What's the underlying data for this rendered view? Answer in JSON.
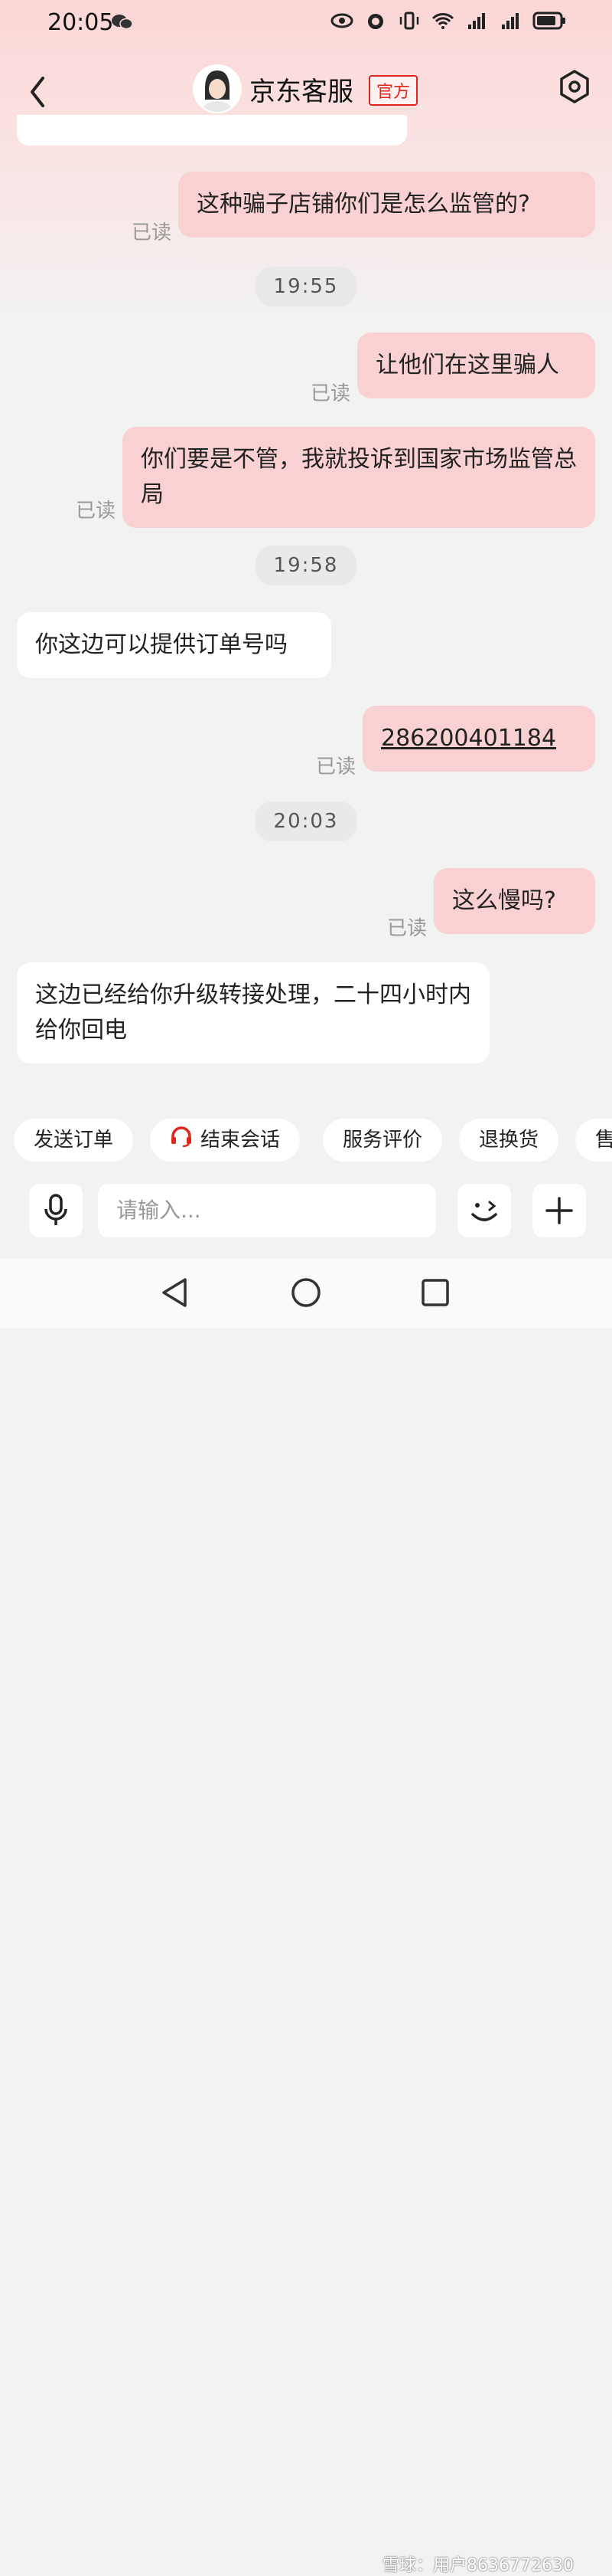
{
  "status": {
    "time": "20:05"
  },
  "header": {
    "title": "京东客服",
    "badge": "官方"
  },
  "messages": [
    {
      "from": "me",
      "text": "这种骗子店铺你们是怎么监管的?",
      "read": "已读"
    },
    {
      "timestamp": "19:55"
    },
    {
      "from": "me",
      "text": "让他们在这里骗人",
      "read": "已读"
    },
    {
      "from": "me",
      "text": "你们要是不管，我就投诉到国家市场监管总局",
      "read": "已读"
    },
    {
      "timestamp": "19:58"
    },
    {
      "from": "them",
      "text": "你这边可以提供订单号吗"
    },
    {
      "from": "me",
      "text": "286200401184",
      "read": "已读"
    },
    {
      "timestamp": "20:03"
    },
    {
      "from": "me",
      "text": "这么慢吗?",
      "read": "已读"
    },
    {
      "from": "them",
      "text": "这边已经给你升级转接处理，二十四小时内给你回电"
    }
  ],
  "quick_actions": [
    "发送订单",
    "结束会话",
    "服务评价",
    "退换货",
    "售"
  ],
  "input": {
    "placeholder": "请输入..."
  },
  "watermark": "雪球：用户8636772630"
}
